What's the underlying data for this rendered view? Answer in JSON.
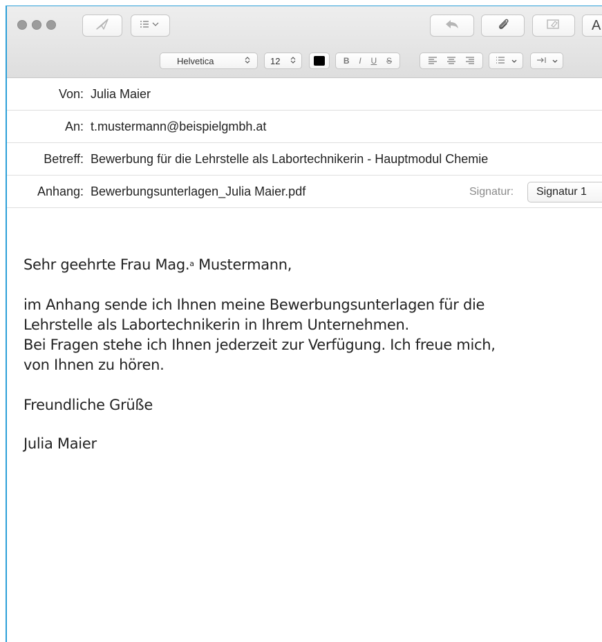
{
  "toolbar": {
    "send_icon": "paper-plane-icon",
    "list_icon": "list-dropdown-icon",
    "reply_icon": "reply-arrow-icon",
    "attach_icon": "paperclip-icon",
    "photo_icon": "photo-browser-icon",
    "format_label": "A"
  },
  "format_bar": {
    "font": "Helvetica",
    "size": "12",
    "color": "#000000",
    "bold": "B",
    "italic": "I",
    "underline": "U",
    "strike": "S"
  },
  "headers": {
    "from_label": "Von:",
    "from_value": "Julia Maier",
    "to_label": "An:",
    "to_value": "t.mustermann@beispielgmbh.at",
    "subject_label": "Betreff:",
    "subject_value": "Bewerbung für die Lehrstelle als Labortechnikerin - Hauptmodul Chemie",
    "attachment_label": "Anhang:",
    "attachment_value": "Bewerbungsunterlagen_Julia Maier.pdf",
    "signature_label": "Signatur:",
    "signature_value": "Signatur 1"
  },
  "body": {
    "salutation_pre": "Sehr geehrte Frau Mag.",
    "salutation_sup": "a",
    "salutation_post": " Mustermann,",
    "line1": "im Anhang sende ich Ihnen meine Bewerbungsunterlagen für die",
    "line2": "Lehrstelle als Labortechnikerin in Ihrem Unternehmen.",
    "line3": "Bei Fragen stehe ich Ihnen jederzeit zur Verfügung. Ich freue mich,",
    "line4": "von Ihnen zu hören.",
    "closing": "Freundliche Grüße",
    "signature": "Julia Maier"
  }
}
